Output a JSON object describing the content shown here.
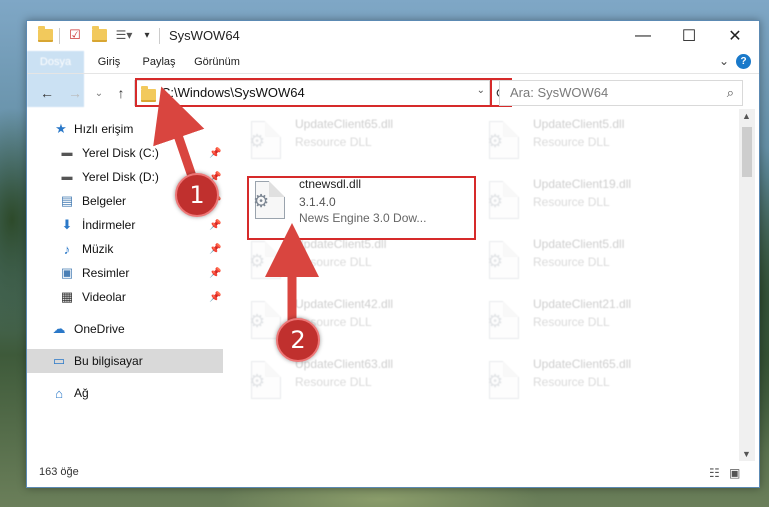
{
  "window": {
    "title": "SysWOW64",
    "minimize_glyph": "—",
    "maximize_glyph": "☐",
    "close_glyph": "✕"
  },
  "ribbon": {
    "tabs": [
      "Dosya",
      "Giriş",
      "Paylaş",
      "Görünüm"
    ],
    "expand_glyph": "⌄",
    "help_glyph": "?"
  },
  "navigation": {
    "back_glyph": "←",
    "forward_glyph": "→",
    "recent_glyph": "⌄",
    "up_glyph": "↑",
    "address_path": "C:\\Windows\\SysWOW64",
    "address_chevron": "⌄",
    "refresh_glyph": "⟳",
    "search_placeholder": "Ara: SysWOW64",
    "search_glyph": "⌕"
  },
  "sidebar": {
    "items": [
      {
        "label": "Hızlı erişim",
        "icon": "star-icon",
        "pinned": false
      },
      {
        "label": "Yerel Disk (C:)",
        "icon": "drive-icon",
        "pinned": true
      },
      {
        "label": "Yerel Disk (D:)",
        "icon": "drive-icon",
        "pinned": true
      },
      {
        "label": "Belgeler",
        "icon": "documents-icon",
        "pinned": true
      },
      {
        "label": "İndirmeler",
        "icon": "download-icon",
        "pinned": true
      },
      {
        "label": "Müzik",
        "icon": "music-icon",
        "pinned": true
      },
      {
        "label": "Resimler",
        "icon": "pictures-icon",
        "pinned": true
      },
      {
        "label": "Videolar",
        "icon": "videos-icon",
        "pinned": true
      },
      {
        "label": "OneDrive",
        "icon": "cloud-icon",
        "pinned": false
      },
      {
        "label": "Bu bilgisayar",
        "icon": "computer-icon",
        "pinned": false,
        "selected": true
      },
      {
        "label": "Ağ",
        "icon": "network-icon",
        "pinned": false
      }
    ],
    "pin_glyph": "📌"
  },
  "files": {
    "left": [
      {
        "name": "UpdateClient65.dll",
        "desc": "Resource DLL"
      },
      {
        "name": "ctnewsdl.dll",
        "desc": "3.1.4.0",
        "desc2": "News Engine 3.0 Dow...",
        "selected": true
      },
      {
        "name": "UpdateClient5.dll",
        "desc": "Resource DLL"
      },
      {
        "name": "UpdateClient42.dll",
        "desc": "Resource DLL"
      },
      {
        "name": "UpdateClient63.dll",
        "desc": "Resource DLL"
      }
    ],
    "right": [
      {
        "name": "UpdateClient5.dll",
        "desc": "Resource DLL"
      },
      {
        "name": "UpdateClient19.dll",
        "desc": "Resource DLL"
      },
      {
        "name": "UpdateClient5.dll",
        "desc": "Resource DLL"
      },
      {
        "name": "UpdateClient21.dll",
        "desc": "Resource DLL"
      },
      {
        "name": "UpdateClient65.dll",
        "desc": "Resource DLL"
      }
    ]
  },
  "status": {
    "item_count": "163 öğe"
  },
  "annotations": {
    "step1": "1",
    "step2": "2",
    "accent_color": "#d62a2a"
  }
}
